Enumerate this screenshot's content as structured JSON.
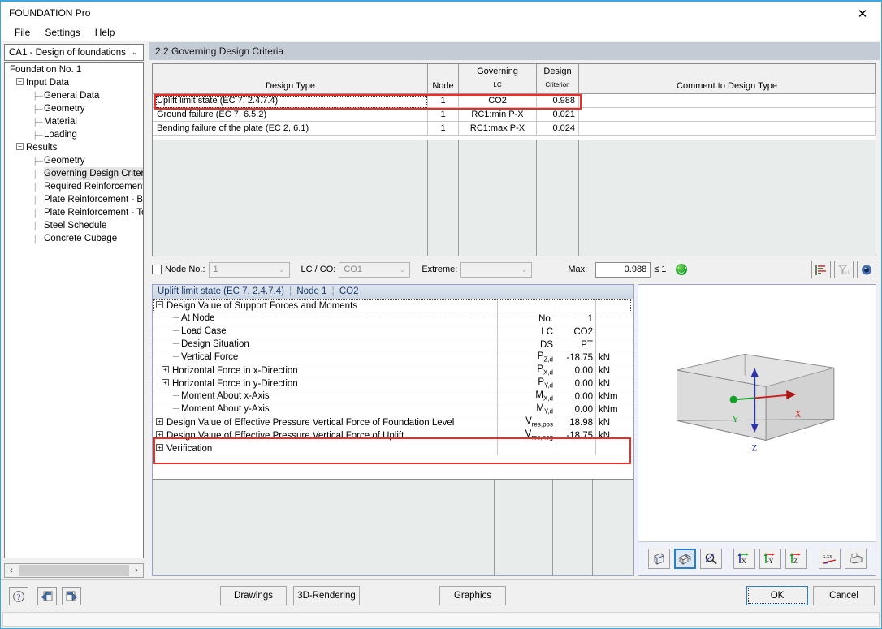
{
  "window": {
    "title": "FOUNDATION Pro",
    "close_label": "✕"
  },
  "menu": {
    "items": [
      {
        "label": "File",
        "accel": "F"
      },
      {
        "label": "Settings",
        "accel": "S"
      },
      {
        "label": "Help",
        "accel": "H"
      }
    ]
  },
  "sidebar": {
    "module_select": {
      "value": "CA1 - Design of foundations",
      "chevron": "⌄"
    },
    "tree": [
      {
        "label": "Foundation No. 1",
        "level": 0,
        "expander": "",
        "selected": false
      },
      {
        "label": "Input Data",
        "level": 1,
        "expander": "−",
        "selected": false
      },
      {
        "label": "General Data",
        "level": 2,
        "expander": "",
        "selected": false
      },
      {
        "label": "Geometry",
        "level": 2,
        "expander": "",
        "selected": false
      },
      {
        "label": "Material",
        "level": 2,
        "expander": "",
        "selected": false
      },
      {
        "label": "Loading",
        "level": 2,
        "expander": "",
        "selected": false
      },
      {
        "label": "Results",
        "level": 1,
        "expander": "−",
        "selected": false
      },
      {
        "label": "Geometry",
        "level": 2,
        "expander": "",
        "selected": false
      },
      {
        "label": "Governing Design Criteria",
        "level": 2,
        "expander": "",
        "selected": true
      },
      {
        "label": "Required Reinforcement",
        "level": 2,
        "expander": "",
        "selected": false
      },
      {
        "label": "Plate Reinforcement - Bottom",
        "level": 2,
        "expander": "",
        "selected": false
      },
      {
        "label": "Plate Reinforcement - Top",
        "level": 2,
        "expander": "",
        "selected": false
      },
      {
        "label": "Steel Schedule",
        "level": 2,
        "expander": "",
        "selected": false
      },
      {
        "label": "Concrete Cubage",
        "level": 2,
        "expander": "",
        "selected": false
      }
    ],
    "scroll_left": "‹",
    "scroll_right": "›"
  },
  "section": {
    "title": "2.2 Governing Design Criteria"
  },
  "criteria_table": {
    "headers": {
      "design_type": "Design Type",
      "node": "Node",
      "governing": "Governing",
      "lc": "LC",
      "design": "Design",
      "criterion": "Criterion",
      "comment": "Comment to Design Type"
    },
    "rows": [
      {
        "design_type": "Uplift limit state (EC 7, 2.4.7.4)",
        "node": "1",
        "lc": "CO2",
        "criterion": "0.988",
        "comment": "",
        "highlighted": true
      },
      {
        "design_type": "Ground failure (EC 7, 6.5.2)",
        "node": "1",
        "lc": "RC1:min P-X",
        "criterion": "0.021",
        "comment": "",
        "highlighted": false
      },
      {
        "design_type": "Bending failure of the plate (EC 2, 6.1)",
        "node": "1",
        "lc": "RC1:max P-X",
        "criterion": "0.024",
        "comment": "",
        "highlighted": false
      }
    ]
  },
  "controls": {
    "node_no_label": "Node No.:",
    "node_no_value": "1",
    "lc_co_label": "LC / CO:",
    "lc_co_value": "CO1",
    "extreme_label": "Extreme:",
    "extreme_value": "",
    "max_label": "Max:",
    "max_value": "0.988",
    "max_limit": "≤ 1",
    "chevron": "⌄",
    "status_icon": "green-smiley-icon",
    "buttons": [
      {
        "name": "result-diagram-button",
        "title": "Result Diagram"
      },
      {
        "name": "filter-button",
        "title": "Filter"
      },
      {
        "name": "visibility-button",
        "title": "Visibility"
      }
    ]
  },
  "detail": {
    "caption": {
      "design_type": "Uplift limit state (EC 7, 2.4.7.4)",
      "node": "Node 1",
      "lc": "CO2",
      "separator": "¦"
    },
    "rows": [
      {
        "kind": "group",
        "expander": "−",
        "label": "Design Value of Support Forces and Moments",
        "sym": "",
        "sub": "",
        "val": "",
        "unit": "",
        "indent": 0,
        "highlighted": false,
        "dotted": true
      },
      {
        "kind": "leaf",
        "expander": "",
        "label": "At Node",
        "sym": "No.",
        "sub": "",
        "val": "1",
        "unit": "",
        "indent": 2,
        "highlighted": false
      },
      {
        "kind": "leaf",
        "expander": "",
        "label": "Load Case",
        "sym": "LC",
        "sub": "",
        "val": "CO2",
        "unit": "",
        "indent": 2,
        "highlighted": false
      },
      {
        "kind": "leaf",
        "expander": "",
        "label": "Design Situation",
        "sym": "DS",
        "sub": "",
        "val": "PT",
        "unit": "",
        "indent": 2,
        "highlighted": false
      },
      {
        "kind": "leaf",
        "expander": "",
        "label": "Vertical Force",
        "sym": "P",
        "sub": "Z,d",
        "val": "-18.75",
        "unit": "kN",
        "indent": 2,
        "highlighted": false
      },
      {
        "kind": "node",
        "expander": "+",
        "label": "Horizontal Force in x-Direction",
        "sym": "P",
        "sub": "X,d",
        "val": "0.00",
        "unit": "kN",
        "indent": 1,
        "highlighted": false
      },
      {
        "kind": "node",
        "expander": "+",
        "label": "Horizontal Force in y-Direction",
        "sym": "P",
        "sub": "Y,d",
        "val": "0.00",
        "unit": "kN",
        "indent": 1,
        "highlighted": false
      },
      {
        "kind": "leaf",
        "expander": "",
        "label": "Moment About x-Axis",
        "sym": "M",
        "sub": "X,d",
        "val": "0.00",
        "unit": "kNm",
        "indent": 2,
        "highlighted": false
      },
      {
        "kind": "leaf",
        "expander": "",
        "label": "Moment About y-Axis",
        "sym": "M",
        "sub": "Y,d",
        "val": "0.00",
        "unit": "kNm",
        "indent": 2,
        "highlighted": false
      },
      {
        "kind": "group",
        "expander": "+",
        "label": "Design Value of Effective Pressure Vertical Force of Foundation Level",
        "sym": "V",
        "sub": "res,pos",
        "val": "18.98",
        "unit": "kN",
        "indent": 0,
        "highlighted": true
      },
      {
        "kind": "group",
        "expander": "+",
        "label": "Design Value of Effective Pressure Vertical Force of Uplift",
        "sym": "V",
        "sub": "res,neg",
        "val": "-18.75",
        "unit": "kN",
        "indent": 0,
        "highlighted": true
      },
      {
        "kind": "group",
        "expander": "+",
        "label": "Verification",
        "sym": "",
        "sub": "",
        "val": "",
        "unit": "",
        "indent": 0,
        "highlighted": false
      }
    ]
  },
  "view3d": {
    "axis_x_label": "X",
    "axis_y_label": "Y",
    "axis_z_label": "Z",
    "toolbar": [
      {
        "name": "wireframe-view-button",
        "title": "Wireframe",
        "active": false
      },
      {
        "name": "solid-view-button",
        "title": "Solid Rendering",
        "active": true
      },
      {
        "name": "zoom-view-button",
        "title": "Zoom",
        "active": false
      },
      {
        "name": "view-in-x-button",
        "title": "View in X",
        "label": "X",
        "active": false
      },
      {
        "name": "view-in-minus-y-button",
        "title": "View in -Y",
        "label": "-Y",
        "active": false
      },
      {
        "name": "view-in-z-button",
        "title": "View in Z",
        "label": "Z",
        "active": false
      },
      {
        "name": "value-display-button",
        "title": "Display Values",
        "label": "x.xx",
        "active": false
      },
      {
        "name": "print-view-button",
        "title": "Print",
        "active": false
      }
    ]
  },
  "bottom": {
    "help_button": "help-icon",
    "prev_button": "previous-icon",
    "next_button": "next-icon",
    "drawings": "Drawings",
    "rendering": "3D-Rendering",
    "graphics": "Graphics",
    "ok": "OK",
    "cancel": "Cancel"
  }
}
